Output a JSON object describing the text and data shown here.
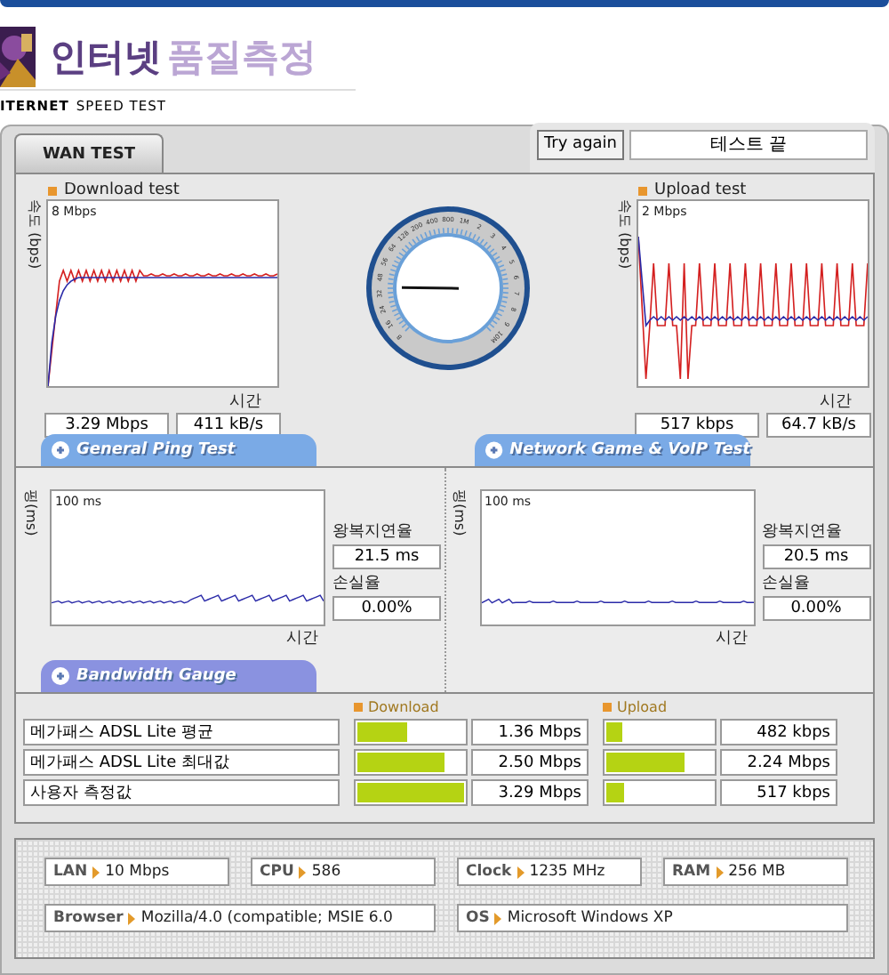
{
  "header": {
    "title_main": "인터넷",
    "title_sub": "품질측정",
    "subtitle_bold": "ITERNET",
    "subtitle": "SPEED TEST"
  },
  "tabs": [
    {
      "label": "WAN TEST",
      "selected": true
    }
  ],
  "try_again": "Try again",
  "status": "테스트 끝",
  "speed_tests": [
    {
      "title": "Download test",
      "y_label": "속도 (bps)",
      "y_max": "8 Mbps",
      "x_label": "시간",
      "rate": "3.29 Mbps",
      "bytes": "411 kB/s"
    },
    {
      "title": "Upload test",
      "y_label": "속도 (bps)",
      "y_max": "2 Mbps",
      "x_label": "시간",
      "rate": "517 kbps",
      "bytes": "64.7 kB/s"
    }
  ],
  "gauge": {
    "labels": [
      "8",
      "16",
      "24",
      "32",
      "48",
      "56",
      "64",
      "128",
      "200",
      "400",
      "800",
      "1M",
      "2",
      "3",
      "4",
      "5",
      "6",
      "7",
      "8",
      "9",
      "10M"
    ]
  },
  "ping_tests": [
    {
      "title": "General Ping Test",
      "y_label": "핑(ms)",
      "y_max": "100 ms",
      "x_label": "시간",
      "latency_label": "왕복지연율",
      "latency": "21.5 ms",
      "loss_label": "손실율",
      "loss": "0.00%"
    },
    {
      "title": "Network Game & VoIP Test",
      "y_label": "핑(ms)",
      "y_max": "100 ms",
      "x_label": "시간",
      "latency_label": "왕복지연율",
      "latency": "20.5 ms",
      "loss_label": "손실율",
      "loss": "0.00%"
    }
  ],
  "bandwidth": {
    "title": "Bandwidth Gauge",
    "download_header": "Download",
    "upload_header": "Upload",
    "rows": [
      {
        "label": "메가패스 ADSL Lite 평균",
        "download": {
          "level": 0.46,
          "text": "1.36 Mbps"
        },
        "upload": {
          "level": 0.15,
          "text": "482 kbps"
        }
      },
      {
        "label": "메가패스 ADSL Lite 최대값",
        "download": {
          "level": 0.82,
          "text": "2.50 Mbps"
        },
        "upload": {
          "level": 0.74,
          "text": "2.24 Mbps"
        }
      },
      {
        "label": "사용자 측정값",
        "download": {
          "level": 1.0,
          "text": "3.29 Mbps"
        },
        "upload": {
          "level": 0.16,
          "text": "517 kbps"
        }
      }
    ]
  },
  "system_info": [
    {
      "label": "LAN",
      "value": "10 Mbps"
    },
    {
      "label": "CPU",
      "value": "586"
    },
    {
      "label": "Clock",
      "value": "1235 MHz"
    },
    {
      "label": "RAM",
      "value": "256 MB"
    },
    {
      "label": "Browser",
      "value": "Mozilla/4.0 (compatible; MSIE 6.0"
    },
    {
      "label": "OS",
      "value": "Microsoft Windows XP"
    }
  ]
}
